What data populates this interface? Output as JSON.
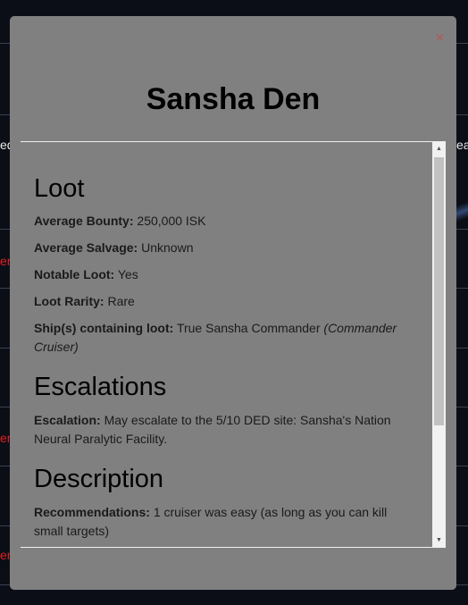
{
  "background": {
    "left_fragments": [
      "ed"
    ],
    "right_fragments": [
      "ear"
    ],
    "red_fragments": [
      "en",
      "en",
      "en"
    ]
  },
  "modal": {
    "close_label": "×",
    "title": "Sansha Den",
    "sections": {
      "loot": {
        "heading": "Loot",
        "average_bounty_label": "Average Bounty:",
        "average_bounty_value": "250,000 ISK",
        "average_salvage_label": "Average Salvage:",
        "average_salvage_value": "Unknown",
        "notable_loot_label": "Notable Loot:",
        "notable_loot_value": "Yes",
        "loot_rarity_label": "Loot Rarity:",
        "loot_rarity_value": "Rare",
        "ships_label": "Ship(s) containing loot:",
        "ships_value": "True Sansha Commander",
        "ships_note": "(Commander Cruiser)"
      },
      "escalations": {
        "heading": "Escalations",
        "escalation_label": "Escalation:",
        "escalation_value": "May escalate to the 5/10 DED site: Sansha's Nation Neural Paralytic Facility."
      },
      "description": {
        "heading": "Description",
        "recommendations_label": "Recommendations:",
        "recommendations_value": "1 cruiser was easy (as long as you can kill small targets)"
      }
    },
    "scrollbar": {
      "up_icon": "▲",
      "down_icon": "▼"
    }
  }
}
